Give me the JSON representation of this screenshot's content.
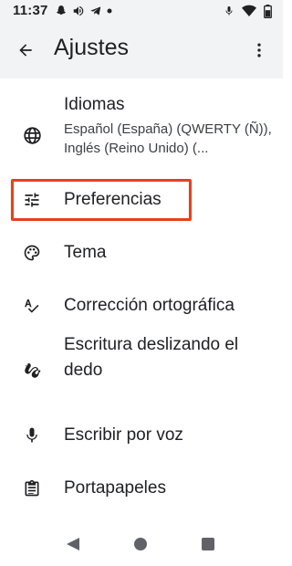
{
  "status_bar": {
    "time": "11:37",
    "left_icons": [
      "snapchat-icon",
      "volume-icon",
      "telegram-icon",
      "dot-icon"
    ],
    "right_icons": [
      "mic-icon",
      "wifi-icon",
      "battery-icon"
    ]
  },
  "app_bar": {
    "title": "Ajustes",
    "back_icon": "arrow-back-icon",
    "overflow_icon": "more-vert-icon"
  },
  "settings": [
    {
      "title": "Idiomas",
      "subtitle": "Español (España) (QWERTY (Ñ)), Inglés (Reino Unido) (...",
      "icon": "globe-icon"
    },
    {
      "title": "Preferencias",
      "icon": "tune-icon",
      "highlighted": true
    },
    {
      "title": "Tema",
      "icon": "palette-icon"
    },
    {
      "title": "Corrección ortográfica",
      "icon": "spellcheck-icon"
    },
    {
      "title": "Escritura deslizando el dedo",
      "icon": "gesture-icon"
    },
    {
      "title": "Escribir por voz",
      "icon": "mic-icon"
    },
    {
      "title": "Portapapeles",
      "icon": "clipboard-icon"
    }
  ],
  "colors": {
    "app_bar_bg": "#f1f3f4",
    "text_primary": "#202124",
    "highlight": "#e8401c",
    "icon": "#202124"
  },
  "nav_bar": [
    "nav-back-icon",
    "nav-home-icon",
    "nav-recents-icon"
  ]
}
